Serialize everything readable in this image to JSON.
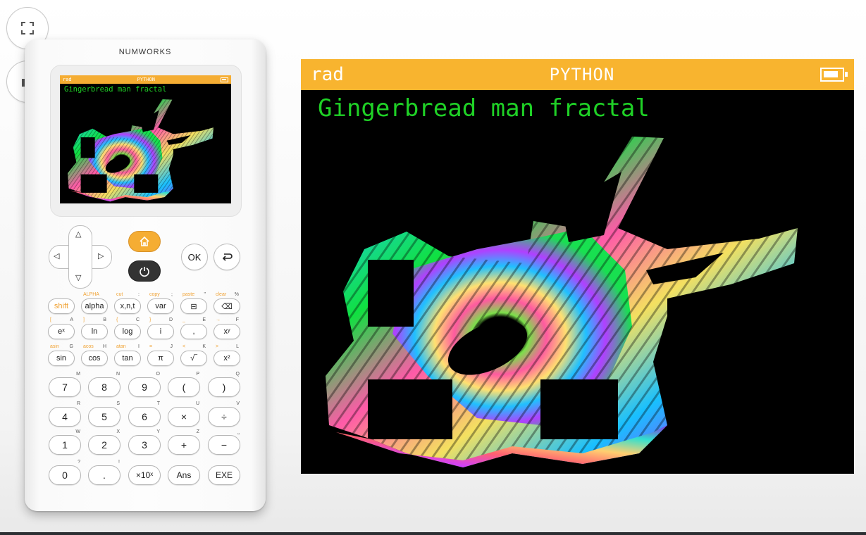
{
  "toolbar": {
    "fullscreen_icon": "fullscreen-icon",
    "screenshot_icon": "camera-icon"
  },
  "calculator": {
    "brand": "NUMWORKS",
    "mini_screen": {
      "angle_mode": "rad",
      "app": "PYTHON",
      "title": "Gingerbread man fractal"
    },
    "nav": {
      "up": "△",
      "down": "▽",
      "left": "◁",
      "right": "▷",
      "home_icon": "home-icon",
      "power_icon": "power-icon",
      "ok": "OK",
      "back_icon": "back-icon"
    },
    "func_rows": [
      [
        {
          "main": "shift",
          "alt": "",
          "sec": ""
        },
        {
          "main": "alpha",
          "alt": "ALPHA",
          "sec": ""
        },
        {
          "main": "x,n,t",
          "alt": "cut",
          "sec": ":"
        },
        {
          "main": "var",
          "alt": "copy",
          "sec": ";"
        },
        {
          "main": "⊟",
          "alt": "paste",
          "sec": "\""
        },
        {
          "main": "⌫",
          "alt": "clear",
          "sec": "%"
        }
      ],
      [
        {
          "main": "eˣ",
          "alt": "[",
          "sec": "A"
        },
        {
          "main": "ln",
          "alt": "]",
          "sec": "B"
        },
        {
          "main": "log",
          "alt": "{",
          "sec": "C"
        },
        {
          "main": "i",
          "alt": "}",
          "sec": "D"
        },
        {
          "main": ",",
          "alt": "_",
          "sec": "E"
        },
        {
          "main": "xʸ",
          "alt": "→",
          "sec": "F"
        }
      ],
      [
        {
          "main": "sin",
          "alt": "asin",
          "sec": "G"
        },
        {
          "main": "cos",
          "alt": "acos",
          "sec": "H"
        },
        {
          "main": "tan",
          "alt": "atan",
          "sec": "I"
        },
        {
          "main": "π",
          "alt": "=",
          "sec": "J"
        },
        {
          "main": "√‾",
          "alt": "<",
          "sec": "K"
        },
        {
          "main": "x²",
          "alt": ">",
          "sec": "L"
        }
      ]
    ],
    "num_rows": [
      [
        {
          "main": "7",
          "sec": "M"
        },
        {
          "main": "8",
          "sec": "N"
        },
        {
          "main": "9",
          "sec": "O"
        },
        {
          "main": "(",
          "sec": "P"
        },
        {
          "main": ")",
          "sec": "Q"
        }
      ],
      [
        {
          "main": "4",
          "sec": "R"
        },
        {
          "main": "5",
          "sec": "S"
        },
        {
          "main": "6",
          "sec": "T"
        },
        {
          "main": "×",
          "sec": "U"
        },
        {
          "main": "÷",
          "sec": "V"
        }
      ],
      [
        {
          "main": "1",
          "sec": "W"
        },
        {
          "main": "2",
          "sec": "X"
        },
        {
          "main": "3",
          "sec": "Y"
        },
        {
          "main": "+",
          "sec": "Z"
        },
        {
          "main": "−",
          "sec": "⎵"
        }
      ],
      [
        {
          "main": "0",
          "sec": "?"
        },
        {
          "main": ".",
          "sec": "!"
        },
        {
          "main": "×10ˣ",
          "sec": ""
        },
        {
          "main": "Ans",
          "sec": ""
        },
        {
          "main": "EXE",
          "sec": ""
        }
      ]
    ]
  },
  "screen": {
    "angle_mode": "rad",
    "app": "PYTHON",
    "battery_icon": "battery-icon",
    "title": "Gingerbread man fractal",
    "graphic": "gingerbread-man-fractal"
  },
  "colors": {
    "status_bar": "#f8b42f",
    "output_text": "#1fd126",
    "home_key": "#f5ad33"
  }
}
